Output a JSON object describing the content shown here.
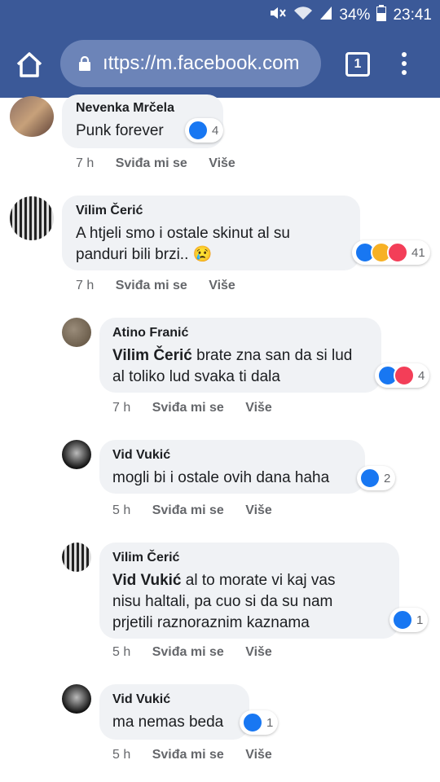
{
  "status": {
    "battery": "34%",
    "time": "23:41"
  },
  "browser": {
    "url": "ıttps://m.facebook.com",
    "tab_count": "1"
  },
  "actions": {
    "like": "Sviđa mi se",
    "more": "Više"
  },
  "comments": [
    {
      "author": "Nevenka Mrčela",
      "text": "Punk forever",
      "reactions": [
        "like"
      ],
      "count": "4",
      "time": "7 h"
    },
    {
      "author": "Vilim Čerić",
      "text": "A htjeli smo i ostale skinut al su panduri bili brzi.. 😢",
      "reactions": [
        "like",
        "haha",
        "love"
      ],
      "count": "41",
      "time": "7 h"
    },
    {
      "author": "Atino Franić",
      "mention": "Vilim Čerić",
      "text": " brate zna san da si lud al toliko lud svaka ti dala",
      "reactions": [
        "like",
        "love"
      ],
      "count": "4",
      "time": "7 h"
    },
    {
      "author": "Vid Vukić",
      "text": "mogli bi i ostale ovih dana haha",
      "reactions": [
        "like"
      ],
      "count": "2",
      "time": "5 h"
    },
    {
      "author": "Vilim Čerić",
      "mention": "Vid Vukić",
      "text": " al to morate vi kaj vas nisu haltali, pa cuo si da su nam prjetili raznoraznim kaznama",
      "reactions": [
        "like"
      ],
      "count": "1",
      "time": "5 h"
    },
    {
      "author": "Vid Vukić",
      "text": "ma nemas beda",
      "reactions": [
        "like"
      ],
      "count": "1",
      "time": "5 h"
    }
  ]
}
